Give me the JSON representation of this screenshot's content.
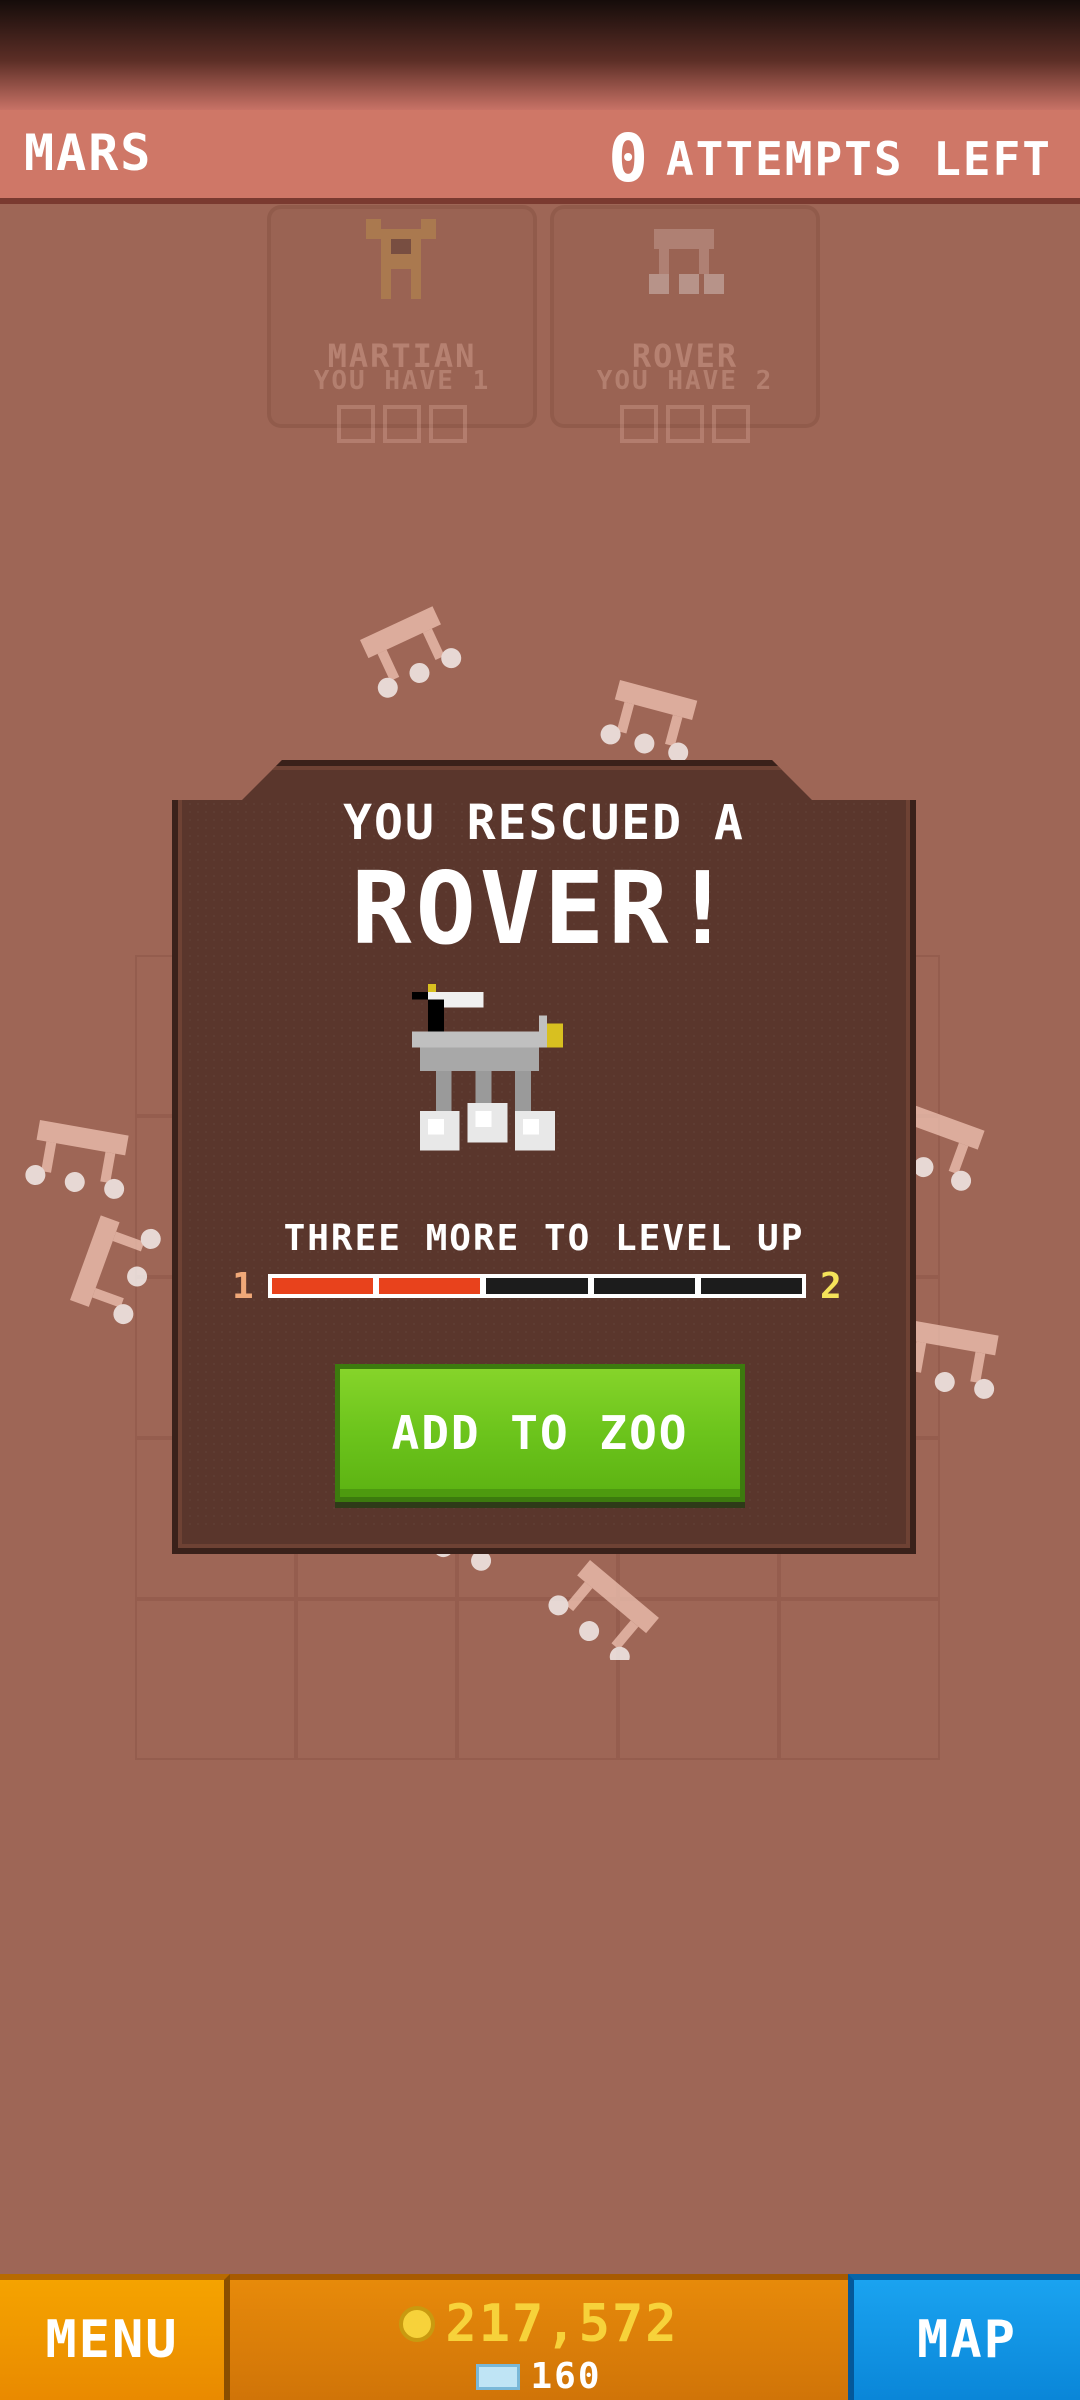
{
  "header": {
    "level_name": "MARS",
    "attempts_count": "0",
    "attempts_label": "ATTEMPTS LEFT"
  },
  "background_cards": [
    {
      "name": "MARTIAN",
      "have": "YOU HAVE 1"
    },
    {
      "name": "ROVER",
      "have": "YOU HAVE 2"
    }
  ],
  "popup": {
    "subtitle": "YOU RESCUED A",
    "headline": "ROVER!",
    "levelup_text": "THREE MORE TO LEVEL UP",
    "level_from": "1",
    "level_to": "2",
    "progress": {
      "filled": 2,
      "total": 5
    },
    "button_label": "ADD TO ZOO"
  },
  "footer": {
    "menu_label": "MENU",
    "coins": "217,572",
    "gems": "160",
    "map_label": "MAP"
  },
  "colors": {
    "progress_fill": "#e8421c",
    "button_green": "#6cc41c",
    "coin_gold": "#f7d23a",
    "map_blue": "#0a86d8",
    "menu_orange": "#f5a300"
  },
  "icons": {
    "coin": "coin-icon",
    "gem": "gem-icon"
  }
}
